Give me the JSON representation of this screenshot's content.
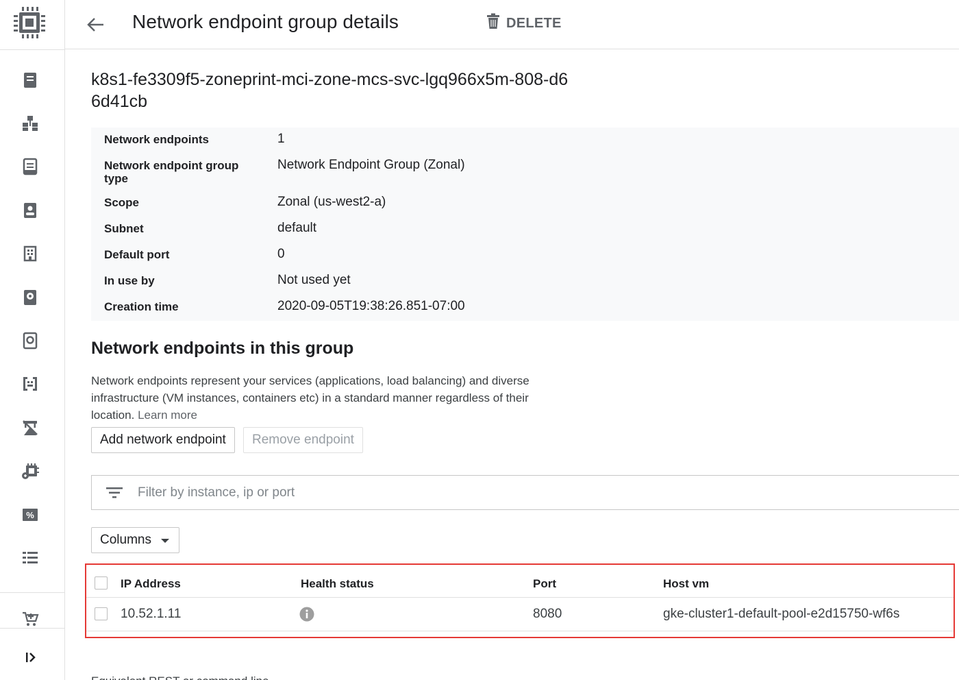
{
  "header": {
    "title": "Network endpoint group details",
    "delete_label": "DELETE"
  },
  "sidebar": {
    "items": [
      {
        "icon": "instances-icon"
      },
      {
        "icon": "instance-groups-icon"
      },
      {
        "icon": "instance-templates-icon"
      },
      {
        "icon": "sole-tenant-nodes-icon"
      },
      {
        "icon": "machine-images-icon"
      },
      {
        "icon": "disks-icon"
      },
      {
        "icon": "snapshots-icon"
      },
      {
        "icon": "images-icon"
      },
      {
        "icon": "tpus-icon"
      },
      {
        "icon": "migrate-vms-icon"
      },
      {
        "icon": "committed-use-discounts-icon"
      },
      {
        "icon": "metadata-icon"
      },
      {
        "icon": "marketplace-icon"
      },
      {
        "icon": "collapse-icon"
      }
    ]
  },
  "neg": {
    "name": "k8s1-fe3309f5-zoneprint-mci-zone-mcs-svc-lgq966x5m-808-d66d41cb"
  },
  "details": [
    {
      "key": "Network endpoints",
      "value": "1"
    },
    {
      "key": "Network endpoint group type",
      "value": "Network Endpoint Group (Zonal)"
    },
    {
      "key": "Scope",
      "value": "Zonal (us-west2-a)"
    },
    {
      "key": "Subnet",
      "value": "default"
    },
    {
      "key": "Default port",
      "value": "0"
    },
    {
      "key": "In use by",
      "value": "Not used yet"
    },
    {
      "key": "Creation time",
      "value": "2020-09-05T19:38:26.851-07:00"
    }
  ],
  "endpoints": {
    "section_title": "Network endpoints in this group",
    "description": "Network endpoints represent your services (applications, load balancing) and diverse infrastructure (VM instances, containers etc) in a standard manner regardless of their location.",
    "learn_more": "Learn more",
    "add_label": "Add network endpoint",
    "remove_label": "Remove endpoint",
    "filter_placeholder": "Filter by instance, ip or port",
    "columns_label": "Columns",
    "table": {
      "headers": [
        "IP Address",
        "Health status",
        "Port",
        "Host vm"
      ],
      "rows": [
        {
          "ip": "10.52.1.11",
          "health_icon": "info-icon",
          "port": "8080",
          "host_vm": "gke-cluster1-default-pool-e2d15750-wf6s"
        }
      ]
    }
  },
  "footer": {
    "text": "Equivalent REST or command line"
  },
  "colors": {
    "highlight_border": "#e53935",
    "detail_bg": "#f8f9fa"
  }
}
